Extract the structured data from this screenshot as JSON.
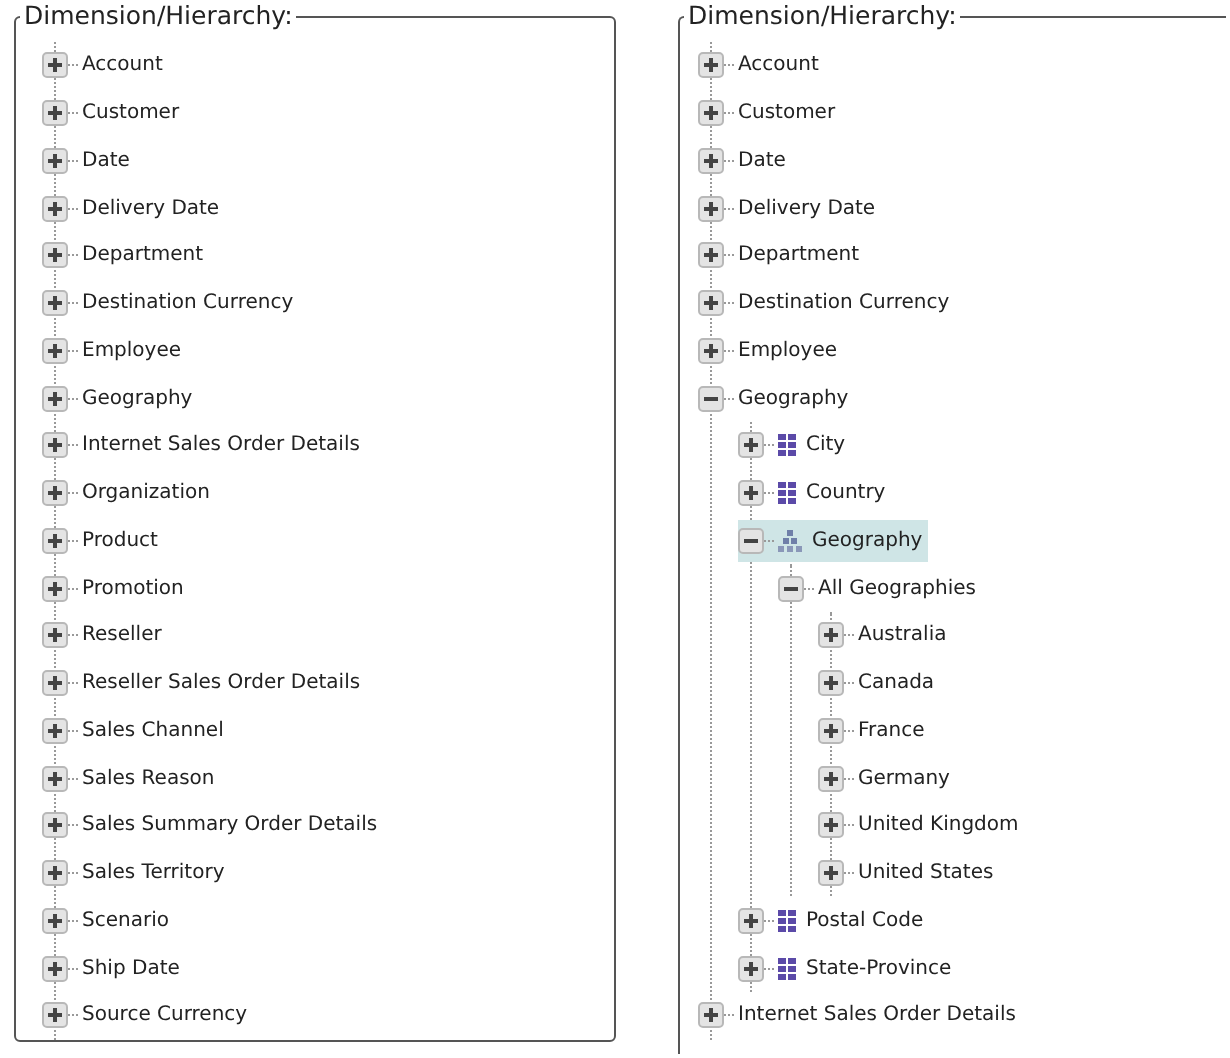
{
  "panels": [
    {
      "legend": "Dimension/Hierarchy:",
      "items": [
        {
          "label": "Account",
          "expanded": false,
          "selected": false
        },
        {
          "label": "Customer",
          "expanded": false,
          "selected": false
        },
        {
          "label": "Date",
          "expanded": false,
          "selected": false
        },
        {
          "label": "Delivery Date",
          "expanded": false,
          "selected": false
        },
        {
          "label": "Department",
          "expanded": false,
          "selected": false
        },
        {
          "label": "Destination Currency",
          "expanded": false,
          "selected": false
        },
        {
          "label": "Employee",
          "expanded": false,
          "selected": false
        },
        {
          "label": "Geography",
          "expanded": false,
          "selected": false
        },
        {
          "label": "Internet Sales Order Details",
          "expanded": false,
          "selected": false
        },
        {
          "label": "Organization",
          "expanded": false,
          "selected": false
        },
        {
          "label": "Product",
          "expanded": false,
          "selected": false
        },
        {
          "label": "Promotion",
          "expanded": false,
          "selected": false
        },
        {
          "label": "Reseller",
          "expanded": false,
          "selected": false
        },
        {
          "label": "Reseller Sales Order Details",
          "expanded": false,
          "selected": false
        },
        {
          "label": "Sales Channel",
          "expanded": false,
          "selected": false
        },
        {
          "label": "Sales Reason",
          "expanded": false,
          "selected": false
        },
        {
          "label": "Sales Summary Order Details",
          "expanded": false,
          "selected": false
        },
        {
          "label": "Sales Territory",
          "expanded": false,
          "selected": false
        },
        {
          "label": "Scenario",
          "expanded": false,
          "selected": false
        },
        {
          "label": "Ship Date",
          "expanded": false,
          "selected": false
        },
        {
          "label": "Source Currency",
          "expanded": false,
          "selected": false
        }
      ]
    },
    {
      "legend": "Dimension/Hierarchy:",
      "items": [
        {
          "label": "Account",
          "expanded": false,
          "selected": false
        },
        {
          "label": "Customer",
          "expanded": false,
          "selected": false
        },
        {
          "label": "Date",
          "expanded": false,
          "selected": false
        },
        {
          "label": "Delivery Date",
          "expanded": false,
          "selected": false
        },
        {
          "label": "Department",
          "expanded": false,
          "selected": false
        },
        {
          "label": "Destination Currency",
          "expanded": false,
          "selected": false
        },
        {
          "label": "Employee",
          "expanded": false,
          "selected": false
        },
        {
          "label": "Geography",
          "expanded": true,
          "selected": false,
          "children": [
            {
              "label": "City",
              "kind": "attribute",
              "expanded": false,
              "selected": false
            },
            {
              "label": "Country",
              "kind": "attribute",
              "expanded": false,
              "selected": false
            },
            {
              "label": "Geography",
              "kind": "hierarchy",
              "expanded": true,
              "selected": true,
              "children": [
                {
                  "label": "All Geographies",
                  "expanded": true,
                  "selected": false,
                  "children": [
                    {
                      "label": "Australia",
                      "expanded": false,
                      "selected": false
                    },
                    {
                      "label": "Canada",
                      "expanded": false,
                      "selected": false
                    },
                    {
                      "label": "France",
                      "expanded": false,
                      "selected": false
                    },
                    {
                      "label": "Germany",
                      "expanded": false,
                      "selected": false
                    },
                    {
                      "label": "United Kingdom",
                      "expanded": false,
                      "selected": false
                    },
                    {
                      "label": "United States",
                      "expanded": false,
                      "selected": false
                    }
                  ]
                }
              ]
            },
            {
              "label": "Postal Code",
              "kind": "attribute",
              "expanded": false,
              "selected": false
            },
            {
              "label": "State-Province",
              "kind": "attribute",
              "expanded": false,
              "selected": false
            }
          ]
        },
        {
          "label": "Internet Sales Order Details",
          "expanded": false,
          "selected": false
        }
      ]
    }
  ]
}
